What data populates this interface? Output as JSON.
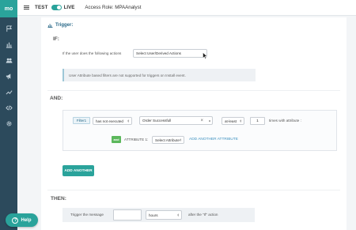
{
  "app": {
    "logo": "mo"
  },
  "sidebar": {
    "items": [
      {
        "icon": "campaign-flag-icon"
      },
      {
        "icon": "analytics-bars-icon"
      },
      {
        "icon": "segments-users-icon"
      },
      {
        "icon": "megaphone-icon"
      },
      {
        "icon": "trend-line-icon"
      },
      {
        "icon": "code-icon"
      },
      {
        "icon": "gear-icon"
      }
    ]
  },
  "topbar": {
    "env_test": "TEST",
    "env_live": "LIVE",
    "live_enabled": true,
    "role_label": "Access Role: MPAAnalyst"
  },
  "trigger": {
    "title": "Trigger:",
    "if_label": "IF:",
    "if_question": "If the user does the following actions",
    "action_select": "Select User/Derived Actions",
    "info_text": "User Attribute based filters are not supported for triggers on Install event."
  },
  "and_section": {
    "label": "AND:",
    "filter_tag": "Filter1",
    "execution_select": "has not executed",
    "event_value": "Order Successfull",
    "event_clear": "×",
    "comparator_select": "at-least",
    "count_value": "1",
    "times_text": "times with attribute :",
    "attr_and_tag": "and",
    "attribute_label": "ATTRIBUTE 1:",
    "attribute_select": "Select Attribute",
    "add_attribute_link": "ADD ANOTHER ATTRIBUTE",
    "add_another_button": "ADD ANOTHER"
  },
  "then_section": {
    "label": "THEN:",
    "trigger_text": "Trigger the message",
    "delay_value": "",
    "unit_select": "hours",
    "after_text": "after the \"If\" action"
  },
  "help": {
    "label": "Help",
    "icon_glyph": "?"
  },
  "colors": {
    "accent": "#2aa39b",
    "rail": "#2c4a5c",
    "link": "#3a8fbf",
    "and_tag": "#5cb85c"
  }
}
